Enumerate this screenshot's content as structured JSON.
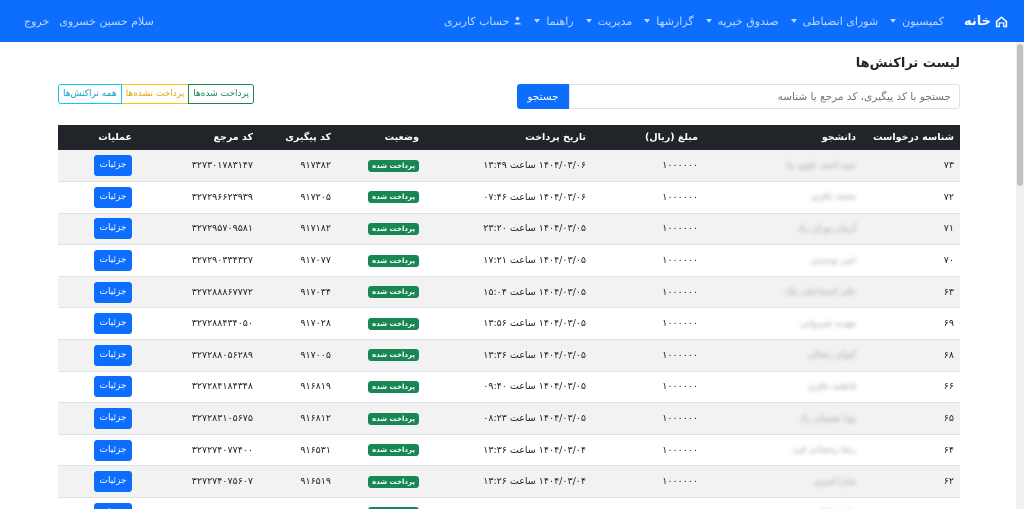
{
  "nav": {
    "brand": "خانه",
    "items": [
      {
        "label": "کمیسیون",
        "dropdown": true
      },
      {
        "label": "شورای انضباطی",
        "dropdown": true
      },
      {
        "label": "صندوق خیریه",
        "dropdown": true
      },
      {
        "label": "گزارشها",
        "dropdown": true
      },
      {
        "label": "مدیریت",
        "dropdown": true
      },
      {
        "label": "راهنما",
        "dropdown": true
      },
      {
        "label": "حساب کاربری",
        "dropdown": false,
        "icon": "user-icon"
      }
    ],
    "greeting": "سلام حسین خسروی",
    "logout": "خروج",
    "bg_color": "#0d6efd"
  },
  "page": {
    "title": "لیست تراکنش‌ها",
    "search_placeholder": "جستجو با کد پیگیری، کد مرجع یا شناسه",
    "search_button": "جستجو",
    "filters": {
      "paid": "پرداخت شده‌ها",
      "unpaid": "پرداخت نشده‌ها",
      "all": "همه تراکنش‌ها"
    }
  },
  "table": {
    "headers": {
      "id": "شناسه درخواست",
      "student": "دانشجو",
      "amount": "مبلغ (ریال)",
      "date": "تاریخ پرداخت",
      "status": "وضعیت",
      "tracking": "کد پیگیری",
      "reference": "کد مرجع",
      "operations": "عملیات"
    },
    "status_label": "پرداخت شده",
    "details_label": "جزئیات",
    "rows": [
      {
        "id": "۷۳",
        "student": "سید احمد علوی نیا",
        "amount": "۱۰۰۰۰۰۰",
        "date": "۱۴۰۴/۰۳/۰۶ ساعت ۱۳:۴۹",
        "tracking": "۹۱۷۳۸۲",
        "reference": "۳۲۷۳۰۱۷۸۳۱۴۷"
      },
      {
        "id": "۷۲",
        "student": "محمد باقری",
        "amount": "۱۰۰۰۰۰۰",
        "date": "۱۴۰۴/۰۳/۰۶ ساعت ۰۷:۴۶",
        "tracking": "۹۱۷۲۰۵",
        "reference": "۳۲۷۲۹۶۶۲۳۹۳۹"
      },
      {
        "id": "۷۱",
        "student": "آرمان پوران راد",
        "amount": "۱۰۰۰۰۰۰",
        "date": "۱۴۰۴/۰۳/۰۵ ساعت ۲۳:۲۰",
        "tracking": "۹۱۷۱۸۲",
        "reference": "۳۲۷۲۹۵۷۰۹۵۸۱"
      },
      {
        "id": "۷۰",
        "student": "امیر توحیدی",
        "amount": "۱۰۰۰۰۰۰",
        "date": "۱۴۰۴/۰۳/۰۵ ساعت ۱۷:۲۱",
        "tracking": "۹۱۷۰۷۷",
        "reference": "۳۲۷۲۹۰۳۳۴۳۲۷"
      },
      {
        "id": "۶۳",
        "student": "علی اسماعیلی نیک",
        "amount": "۱۰۰۰۰۰۰",
        "date": "۱۴۰۴/۰۳/۰۵ ساعت ۱۵:۰۴",
        "tracking": "۹۱۷۰۳۴",
        "reference": "۳۲۷۲۸۸۸۶۷۷۷۲"
      },
      {
        "id": "۶۹",
        "student": "مهدیه شیروانی",
        "amount": "۱۰۰۰۰۰۰",
        "date": "۱۴۰۴/۰۳/۰۵ ساعت ۱۳:۵۶",
        "tracking": "۹۱۷۰۲۸",
        "reference": "۳۲۷۲۸۸۴۳۴۰۵۰"
      },
      {
        "id": "۶۸",
        "student": "کیوان رضائی",
        "amount": "۱۰۰۰۰۰۰",
        "date": "۱۴۰۴/۰۳/۰۵ ساعت ۱۳:۳۶",
        "tracking": "۹۱۷۰۰۵",
        "reference": "۳۲۷۲۸۸۰۵۶۲۸۹"
      },
      {
        "id": "۶۶",
        "student": "فاطمه باقری",
        "amount": "۱۰۰۰۰۰۰",
        "date": "۱۴۰۴/۰۳/۰۵ ساعت ۰۹:۴۰",
        "tracking": "۹۱۶۸۱۹",
        "reference": "۳۲۷۲۸۴۱۸۴۳۴۸"
      },
      {
        "id": "۶۵",
        "student": "پویا نعیمیان راد",
        "amount": "۱۰۰۰۰۰۰",
        "date": "۱۴۰۴/۰۳/۰۵ ساعت ۰۸:۲۳",
        "tracking": "۹۱۶۸۱۲",
        "reference": "۳۲۷۲۸۳۱۰۵۶۷۵"
      },
      {
        "id": "۶۴",
        "student": "رضا رمضانی فرد",
        "amount": "۱۰۰۰۰۰۰",
        "date": "۱۴۰۴/۰۳/۰۴ ساعت ۱۳:۳۶",
        "tracking": "۹۱۶۵۳۱",
        "reference": "۳۲۷۲۷۴۰۷۷۴۰۰"
      },
      {
        "id": "۶۲",
        "student": "سارا امیری",
        "amount": "۱۰۰۰۰۰۰",
        "date": "۱۴۰۴/۰۳/۰۴ ساعت ۱۳:۲۶",
        "tracking": "۹۱۶۵۱۹",
        "reference": "۳۲۷۲۷۴۰۷۵۶۰۷"
      },
      {
        "id": "۶۱",
        "student": "علیرضا کریمی",
        "amount": "۱۰۰۰۰۰۰",
        "date": "۱۴۰۴/۰۳/۰۴ ساعت ۱۱:۰۵",
        "tracking": "۹۱۶۴۰۳",
        "reference": "۳۲۷۲۷۲۳۸۱۹۰۶"
      }
    ]
  }
}
